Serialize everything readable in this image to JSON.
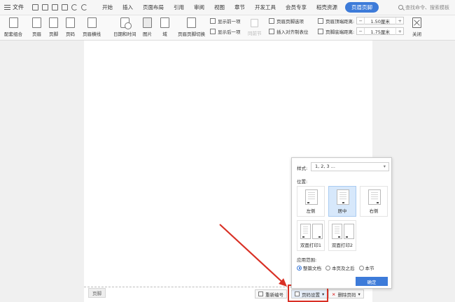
{
  "menubar": {
    "file_label": "文件",
    "tabs": [
      "开始",
      "插入",
      "页面布局",
      "引用",
      "审阅",
      "视图",
      "章节",
      "开发工具",
      "会员专享",
      "稻壳资源"
    ],
    "active_tab": "页眉页脚",
    "search_placeholder": "查找命令、搜索模板"
  },
  "ribbon": {
    "group1": [
      "配套组合",
      "页眉",
      "页脚",
      "页码",
      "页眉横线"
    ],
    "group2": [
      "日期和时间",
      "图片",
      "域"
    ],
    "switch_label": "页眉页脚切换",
    "show_prev": "显示前一项",
    "show_next": "显示后一项",
    "same_as_prev": "同前节",
    "options_label": "页眉页脚选项",
    "insert_tab": "插入对齐制表位",
    "header_top_label": "页眉顶端距离:",
    "header_top_value": "1.50厘米",
    "footer_bottom_label": "页脚底端距离:",
    "footer_bottom_value": "1.75厘米",
    "close_label": "关闭"
  },
  "footer_area": {
    "tag": "页脚",
    "renumber": "重新编号",
    "page_setup": "页码设置",
    "delete": "删除页码"
  },
  "popup": {
    "style_label": "样式:",
    "style_value": "1, 2, 3 ...",
    "position_label": "位置:",
    "positions": [
      "左侧",
      "居中",
      "右侧",
      "双面打印1",
      "双面打印2"
    ],
    "selected_position": "居中",
    "scope_label": "应用范围:",
    "scopes": [
      "整篇文档",
      "本页及之后",
      "本节"
    ],
    "selected_scope": "整篇文档",
    "ok": "确定"
  },
  "colors": {
    "accent": "#3d7bd9",
    "highlight": "#d93025"
  }
}
